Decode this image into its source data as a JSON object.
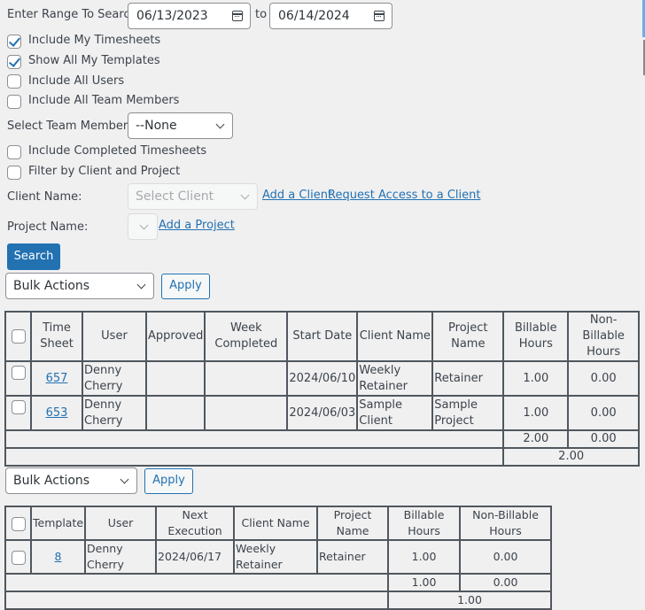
{
  "search": {
    "range_label": "Enter Range To Search:",
    "start_date": "06/13/2023",
    "to_label": "to",
    "end_date": "06/14/2024",
    "checkboxes": [
      {
        "label": "Include My Timesheets",
        "checked": true
      },
      {
        "label": "Show All My Templates",
        "checked": true
      },
      {
        "label": "Include All Users",
        "checked": false
      },
      {
        "label": "Include All Team Members",
        "checked": false
      }
    ],
    "team_member_label": "Select Team Member",
    "team_member_value": "--None",
    "checkboxes2": [
      {
        "label": "Include Completed Timesheets",
        "checked": false
      },
      {
        "label": "Filter by Client and Project",
        "checked": false
      }
    ],
    "client_label": "Client Name:",
    "client_placeholder": "Select Client",
    "add_client_link": "Add a Client",
    "request_access_link": "Request Access to a Client",
    "project_label": "Project Name:",
    "project_value": "",
    "add_project_link": "Add a Project",
    "search_button": "Search"
  },
  "timesheets": {
    "bulk_actions": "Bulk Actions",
    "apply": "Apply",
    "headers": [
      "Time Sheet",
      "User",
      "Approved",
      "Week Completed",
      "Start Date",
      "Client Name",
      "Project Name",
      "Billable Hours",
      "Non-Billable Hours"
    ],
    "rows": [
      {
        "id": "657",
        "user": "Denny Cherry",
        "approved": "",
        "week_completed": "",
        "start_date": "2024/06/10",
        "client": "Weekly Retainer",
        "project": "Retainer",
        "billable": "1.00",
        "non_billable": "0.00"
      },
      {
        "id": "653",
        "user": "Denny Cherry",
        "approved": "",
        "week_completed": "",
        "start_date": "2024/06/03",
        "client": "Sample Client",
        "project": "Sample Project",
        "billable": "1.00",
        "non_billable": "0.00"
      }
    ],
    "total_billable": "2.00",
    "total_non_billable": "0.00",
    "grand_total": "2.00"
  },
  "templates": {
    "bulk_actions": "Bulk Actions",
    "apply": "Apply",
    "headers": [
      "Template",
      "User",
      "Next Execution",
      "Client Name",
      "Project Name",
      "Billable Hours",
      "Non-Billable Hours"
    ],
    "rows": [
      {
        "id": "8",
        "user": "Denny Cherry",
        "next_execution": "2024/06/17",
        "client": "Weekly Retainer",
        "project": "Retainer",
        "billable": "1.00",
        "non_billable": "0.00"
      }
    ],
    "total_billable": "1.00",
    "total_non_billable": "0.00",
    "grand_total": "1.00"
  },
  "colors": {
    "accent": "#2271b1",
    "background": "#f0f0f1",
    "table_border": "#50575e"
  }
}
